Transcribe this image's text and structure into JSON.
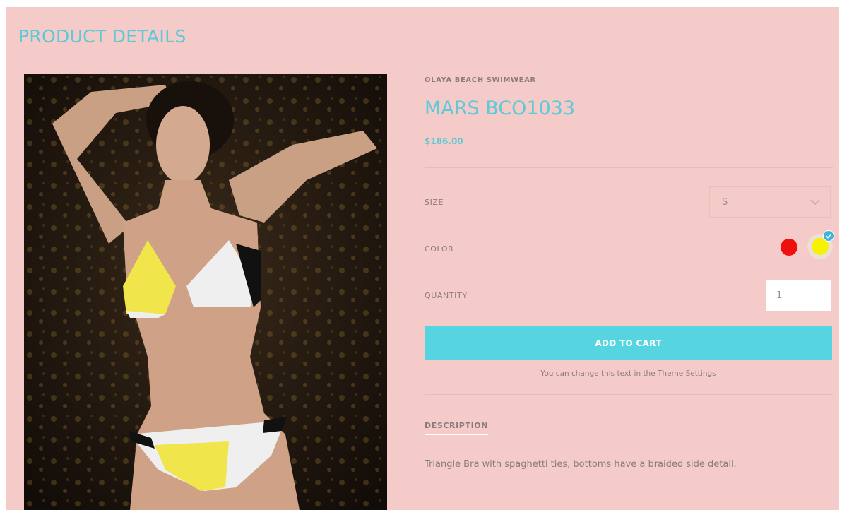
{
  "page": {
    "title": "PRODUCT DETAILS"
  },
  "product": {
    "image_alt": "Model wearing yellow, white and black triangle bikini with body chain",
    "brand": "OLAYA BEACH SWIMWEAR",
    "name": "MARS BCO1033",
    "price": "$186.00"
  },
  "options": {
    "size_label": "SIZE",
    "size_value": "S",
    "color_label": "COLOR",
    "colors": [
      {
        "name": "red",
        "hex": "#ee0f0f",
        "selected": false
      },
      {
        "name": "yellow",
        "hex": "#f7f104",
        "selected": true
      }
    ],
    "quantity_label": "QUANTITY",
    "quantity_value": "1"
  },
  "actions": {
    "add_to_cart_label": "ADD TO CART",
    "theme_note": "You can change this text in the Theme Settings"
  },
  "description": {
    "heading": "DESCRIPTION",
    "text": "Triangle Bra with spaghetti ties, bottoms have a braided side detail."
  },
  "icons": {
    "size_dropdown": "chevron-down-icon",
    "selected_color": "check-icon"
  },
  "colors": {
    "accent": "#5ec9d8",
    "button": "#56d4e0",
    "background": "#f4cbc8"
  }
}
